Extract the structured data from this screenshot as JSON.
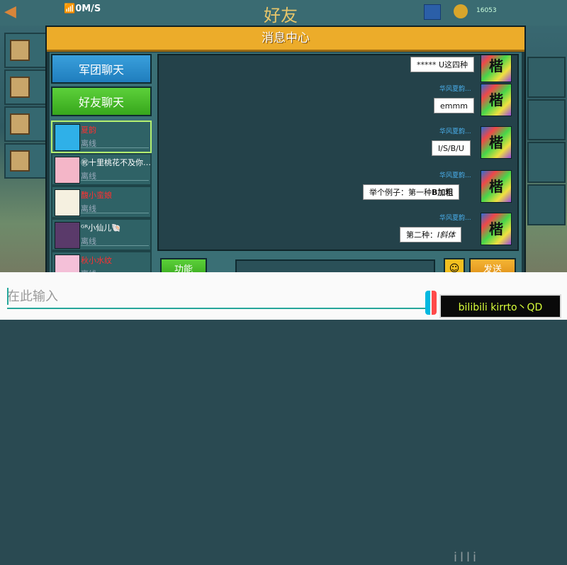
{
  "status_bar": {
    "network_speed": "0M/S"
  },
  "background": {
    "title": "好友",
    "coins": "16053",
    "logo_text": "ill"
  },
  "dialog": {
    "title": "消息中心"
  },
  "tabs": [
    {
      "label": "军团聊天"
    },
    {
      "label": "好友聊天"
    }
  ],
  "friends": [
    {
      "name": "夏韵",
      "status": "离线",
      "name_red": true
    },
    {
      "name": "㊗十里桃花不及你…",
      "status": "离线",
      "name_red": false
    },
    {
      "name": "馥小蛮娘",
      "status": "离线",
      "name_red": true
    },
    {
      "name": "ᴳᴿ小仙儿🐚",
      "status": "离线",
      "name_red": false
    },
    {
      "name": "秋小水纹",
      "status": "离线",
      "name_red": true
    }
  ],
  "messages": [
    {
      "sender": "",
      "text": "***** U这四种"
    },
    {
      "sender": "华风夏韵...",
      "text": "emmm"
    },
    {
      "sender": "华风夏韵...",
      "text": "I/S/B/U"
    },
    {
      "sender": "华风夏韵...",
      "text_plain": "举个例子：第一种",
      "text_bold": "B加粗"
    },
    {
      "sender": "华风夏韵...",
      "text_plain": "第二种：",
      "text_italic": "I斜体"
    }
  ],
  "msg_avatar_glyph": "楷",
  "bottom": {
    "function_label": "功能",
    "send_label": "发送",
    "emoji": "☺"
  },
  "ime": {
    "placeholder": "在此输入"
  },
  "watermark": {
    "text": "bilibili kirrto丶QD",
    "ghost": "illi"
  },
  "colors": {
    "header": "#ecac2a",
    "team_tab": "#1f7dbd",
    "friend_tab": "#37a71c",
    "sender": "#4ab0ee",
    "send_btn": "#dd8d17"
  }
}
